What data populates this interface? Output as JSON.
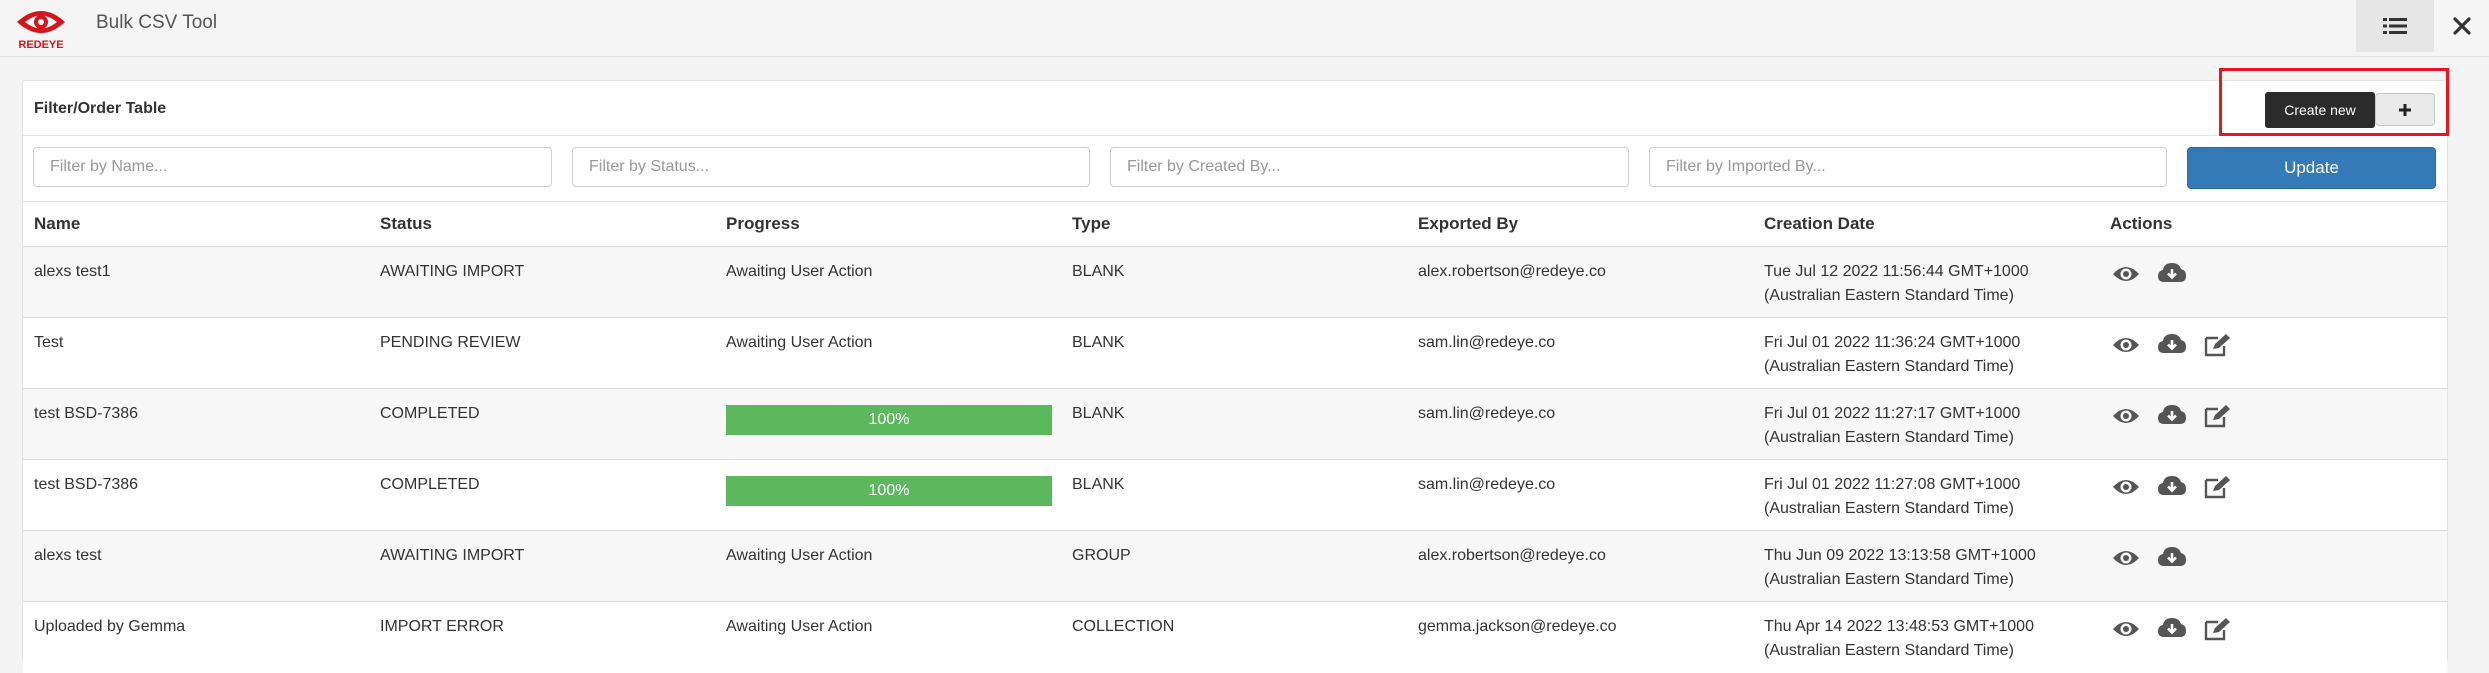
{
  "app": {
    "brand": "REDEYE",
    "title": "Bulk CSV Tool",
    "list_icon": "list-icon",
    "close_icon": "close-icon"
  },
  "panel": {
    "title": "Filter/Order Table",
    "tooltip": "Create new",
    "create_icon": "plus-icon"
  },
  "filters": {
    "name_placeholder": "Filter by Name...",
    "status_placeholder": "Filter by Status...",
    "created_by_placeholder": "Filter by Created By...",
    "imported_by_placeholder": "Filter by Imported By...",
    "update_label": "Update"
  },
  "table": {
    "headers": {
      "name": "Name",
      "status": "Status",
      "progress": "Progress",
      "type": "Type",
      "exported_by": "Exported By",
      "creation_date": "Creation Date",
      "actions": "Actions"
    },
    "rows": [
      {
        "name": "alexs test1",
        "status": "AWAITING IMPORT",
        "progress": "Awaiting User Action",
        "type": "BLANK",
        "exported_by": "alex.robertson@redeye.co",
        "date_line1": "Tue Jul 12 2022 11:56:44 GMT+1000",
        "date_line2": "(Australian Eastern Standard Time)"
      },
      {
        "name": "Test",
        "status": "PENDING REVIEW",
        "progress": "Awaiting User Action",
        "type": "BLANK",
        "exported_by": "sam.lin@redeye.co",
        "date_line1": "Fri Jul 01 2022 11:36:24 GMT+1000",
        "date_line2": "(Australian Eastern Standard Time)"
      },
      {
        "name": "test BSD-7386",
        "status": "COMPLETED",
        "progress": "100%",
        "progress_value": 1.0,
        "type": "BLANK",
        "exported_by": "sam.lin@redeye.co",
        "date_line1": "Fri Jul 01 2022 11:27:17 GMT+1000",
        "date_line2": "(Australian Eastern Standard Time)"
      },
      {
        "name": "test BSD-7386",
        "status": "COMPLETED",
        "progress": "100%",
        "progress_value": 1.0,
        "type": "BLANK",
        "exported_by": "sam.lin@redeye.co",
        "date_line1": "Fri Jul 01 2022 11:27:08 GMT+1000",
        "date_line2": "(Australian Eastern Standard Time)"
      },
      {
        "name": "alexs test",
        "status": "AWAITING IMPORT",
        "progress": "Awaiting User Action",
        "type": "GROUP",
        "exported_by": "alex.robertson@redeye.co",
        "date_line1": "Thu Jun 09 2022 13:13:58 GMT+1000",
        "date_line2": "(Australian Eastern Standard Time)"
      },
      {
        "name": "Uploaded by Gemma",
        "status": "IMPORT ERROR",
        "progress": "Awaiting User Action",
        "type": "COLLECTION",
        "exported_by": "gemma.jackson@redeye.co",
        "date_line1": "Thu Apr 14 2022 13:48:53 GMT+1000",
        "date_line2": "(Australian Eastern Standard Time)"
      }
    ]
  },
  "colors": {
    "primary": "#337ab7",
    "success": "#5cb85c",
    "highlight": "#e8161e",
    "brand_red": "#d7141a"
  }
}
